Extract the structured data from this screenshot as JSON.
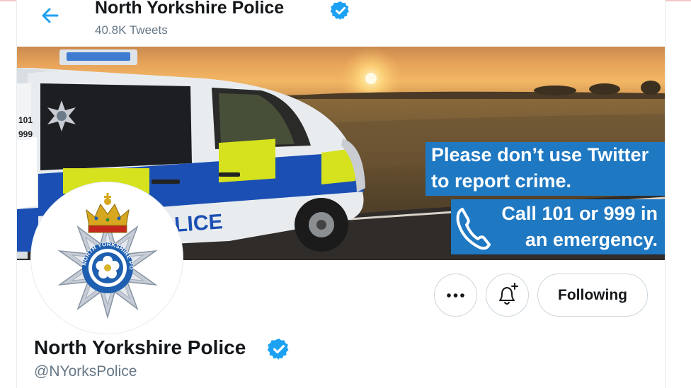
{
  "header": {
    "name": "North Yorkshire Police",
    "tweet_count": "40.8K Tweets"
  },
  "banner": {
    "message_line1": "Please don’t use Twitter",
    "message_line2": "to report crime.",
    "call_line1": "Call 101 or 999 in",
    "call_line2": "an emergency.",
    "van_text": "LICE",
    "van_numbers": [
      "101",
      "999"
    ]
  },
  "actions": {
    "more_label": "•••",
    "following_label": "Following"
  },
  "profile": {
    "name": "North Yorkshire Police",
    "handle": "@NYorksPolice",
    "badge_text": "NORTH YORKSHIRE POLICE"
  },
  "colors": {
    "accent": "#1da1f2",
    "banner_blue": "#1f78c2",
    "text_primary": "#14171a",
    "text_secondary": "#657786"
  },
  "icons": [
    "back-arrow-icon",
    "verified-badge-icon",
    "phone-icon",
    "more-icon",
    "notification-bell-icon"
  ]
}
